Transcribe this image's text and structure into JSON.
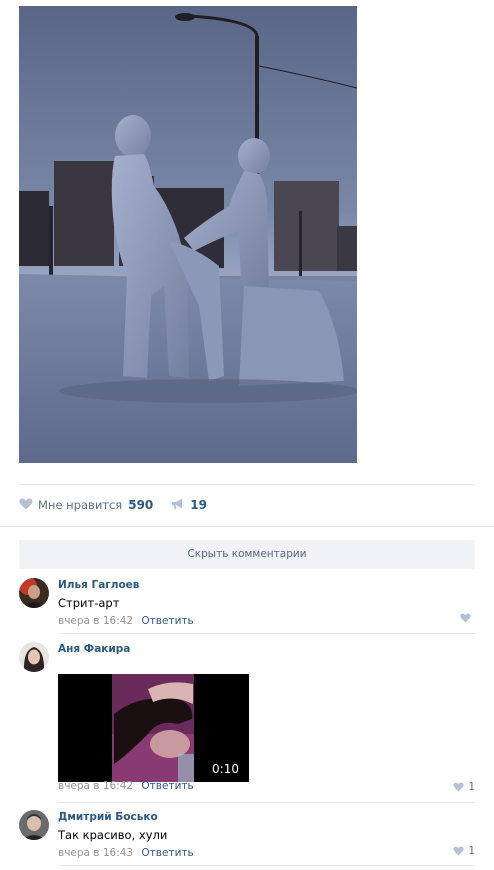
{
  "post": {
    "likes_label": "Мне нравится",
    "likes_count": "590",
    "shares_count": "19"
  },
  "comments_toggle": "Скрыть комментарии",
  "comments": [
    {
      "author": "Илья Гаглоев",
      "text": "Стрит-арт",
      "time": "вчера в 16:42",
      "reply": "Ответить",
      "likes": ""
    },
    {
      "author": "Аня Факира",
      "text": "",
      "video_duration": "0:10",
      "time": "вчера в 16:42",
      "reply": "Ответить",
      "likes": "1"
    },
    {
      "author": "Дмитрий Босько",
      "text": "Так красиво, хули",
      "time": "вчера в 16:43",
      "reply": "Ответить",
      "likes": "1"
    }
  ],
  "colors": {
    "link": "#2a5885",
    "muted": "#939393",
    "action": "#5f6c80",
    "button_bg": "#f0f2f5"
  }
}
